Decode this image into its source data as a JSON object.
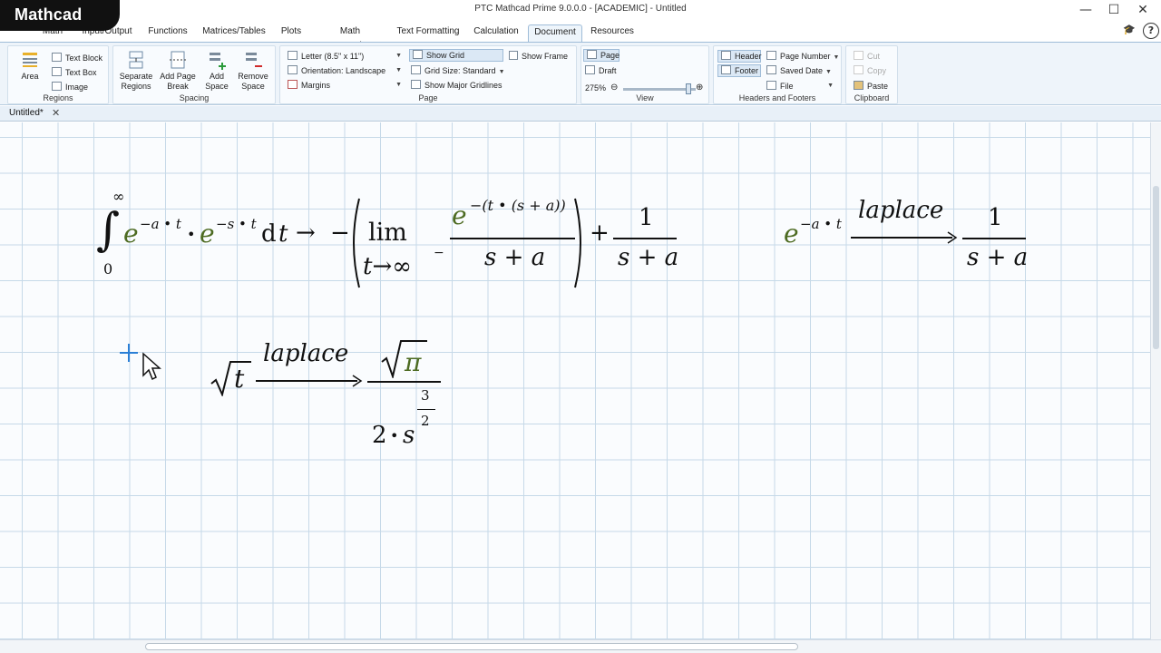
{
  "app": {
    "logo": "Mathcad",
    "window_title": "PTC Mathcad Prime 9.0.0.0 - [ACADEMIC] - Untitled"
  },
  "window_buttons": {
    "minimize": "—",
    "maximize": "☐",
    "close": "✕"
  },
  "tabs": [
    {
      "label": "Math"
    },
    {
      "label": "Input/Output"
    },
    {
      "label": "Functions"
    },
    {
      "label": "Matrices/Tables"
    },
    {
      "label": "Plots"
    },
    {
      "label": "Math Formatting"
    },
    {
      "label": "Text Formatting"
    },
    {
      "label": "Calculation"
    },
    {
      "label": "Document"
    },
    {
      "label": "Resources"
    }
  ],
  "active_tab": "Document",
  "ribbon": {
    "regions": {
      "label": "Regions",
      "area": "Area",
      "text_block": "Text Block",
      "text_box": "Text Box",
      "image": "Image"
    },
    "spacing": {
      "label": "Spacing",
      "separate_regions_1": "Separate",
      "separate_regions_2": "Regions",
      "add_page_break_1": "Add Page",
      "add_page_break_2": "Break",
      "add_space_1": "Add",
      "add_space_2": "Space",
      "remove_space_1": "Remove",
      "remove_space_2": "Space"
    },
    "page": {
      "label": "Page",
      "paper": "Letter (8.5\" x 11\")",
      "orientation_label": "Orientation:",
      "orientation_value": "Landscape",
      "margins": "Margins",
      "show_grid": "Show Grid",
      "grid_size_label": "Grid Size:",
      "grid_size_value": "Standard",
      "show_major_gridlines": "Show Major Gridlines",
      "show_frame": "Show Frame"
    },
    "view": {
      "label": "View",
      "page": "Page",
      "draft": "Draft",
      "zoom": "275%",
      "zoom_level": 0.9
    },
    "headers": {
      "label": "Headers and Footers",
      "header": "Header",
      "footer": "Footer",
      "page_number": "Page Number",
      "saved_date": "Saved Date",
      "file": "File"
    },
    "clipboard": {
      "label": "Clipboard",
      "cut": "Cut",
      "copy": "Copy",
      "paste": "Paste"
    }
  },
  "document_tab": {
    "title": "Untitled*",
    "close": "✕"
  },
  "math": {
    "eq1": {
      "upper": "∞",
      "lower": "0",
      "integral": "∫",
      "e1": "e",
      "exp1": "−a • t",
      "dot": "•",
      "e2": "e",
      "exp2": "−s • t",
      "d": "d",
      "dt_var": "t",
      "arrow": "→",
      "minus": "−",
      "lim": "lim",
      "lim_sub": "t→∞",
      "lim_sub_inf": "∞",
      "lim_sup": "−",
      "num_e": "e",
      "num_exp": "−(t • (s + a))",
      "den": "s + a",
      "plus": "+",
      "num2": "1",
      "den2": "s + a"
    },
    "eq2": {
      "e": "e",
      "exp": "−a • t",
      "keyword": "laplace",
      "num": "1",
      "den": "s + a"
    },
    "eq3": {
      "radical": "√",
      "arg": "t",
      "keyword": "laplace",
      "num_rad": "√",
      "num_arg": "π",
      "den_coef": "2",
      "den_dot": "•",
      "den_var": "s",
      "pow_num": "3",
      "pow_den": "2"
    }
  }
}
